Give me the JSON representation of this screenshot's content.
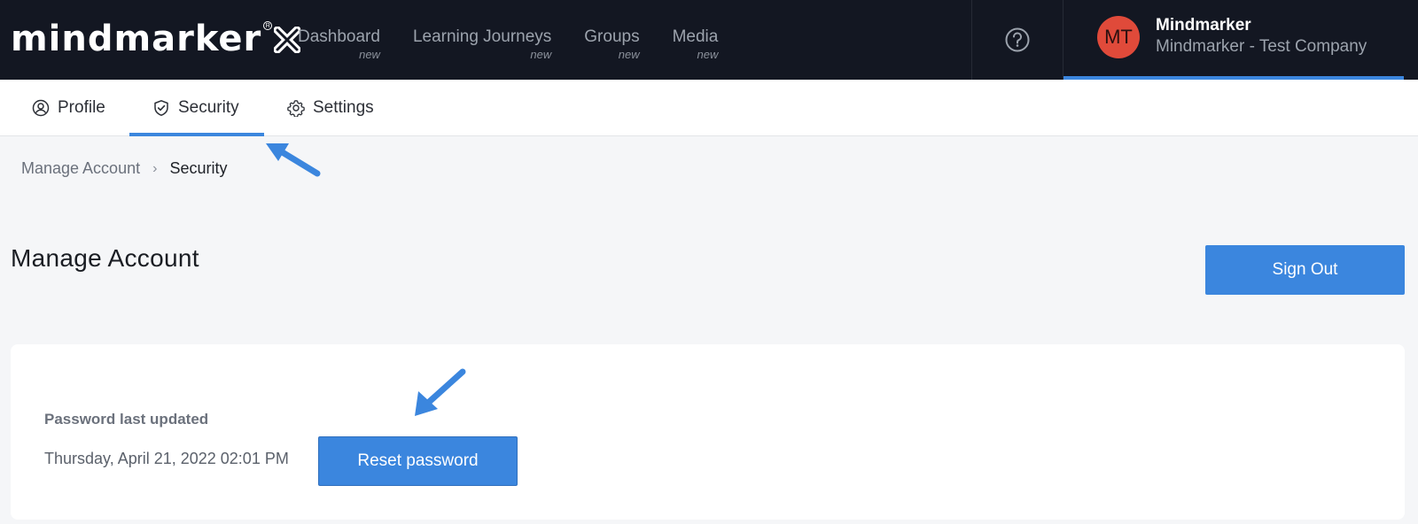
{
  "header": {
    "logo_text": "mindmarker",
    "nav": [
      {
        "label": "Dashboard",
        "badge": "new"
      },
      {
        "label": "Learning Journeys",
        "badge": "new"
      },
      {
        "label": "Groups",
        "badge": "new"
      },
      {
        "label": "Media",
        "badge": "new"
      }
    ],
    "user": {
      "initials": "MT",
      "name": "Mindmarker",
      "company": "Mindmarker - Test Company"
    }
  },
  "tabs": [
    {
      "label": "Profile",
      "icon": "user-circle-icon"
    },
    {
      "label": "Security",
      "icon": "shield-check-icon",
      "active": true
    },
    {
      "label": "Settings",
      "icon": "gear-icon"
    }
  ],
  "breadcrumb": {
    "parent": "Manage Account",
    "current": "Security"
  },
  "page": {
    "title": "Manage Account",
    "sign_out_label": "Sign Out"
  },
  "password": {
    "label": "Password last updated",
    "last_updated": "Thursday, April 21, 2022 02:01 PM",
    "reset_label": "Reset password"
  },
  "colors": {
    "topbar": "#131722",
    "accent": "#3b86de",
    "avatar": "#e04a3a"
  }
}
